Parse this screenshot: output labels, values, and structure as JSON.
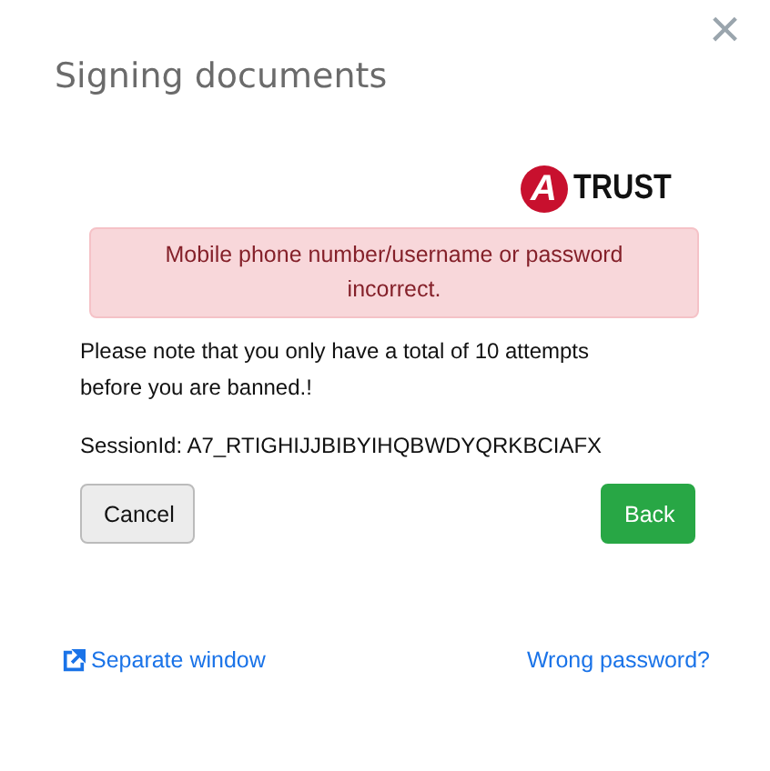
{
  "dialog": {
    "title": "Signing documents",
    "close": "×"
  },
  "logo": {
    "mark": "A",
    "text": "TRUST"
  },
  "alert": {
    "message": "Mobile phone number/username or password incorrect."
  },
  "note": "Please note that you only have a total of 10 attempts before you are banned.!",
  "session": "SessionId: A7_RTIGHIJJBIBYIHQBWDYQRKBCIAFX",
  "buttons": [
    {
      "label": "Cancel",
      "kind": "secondary"
    },
    {
      "label": "Back",
      "kind": "primary"
    }
  ],
  "links": [
    {
      "label": "Separate window",
      "kind": "external"
    },
    {
      "label": "Wrong password?",
      "kind": "plain"
    }
  ]
}
